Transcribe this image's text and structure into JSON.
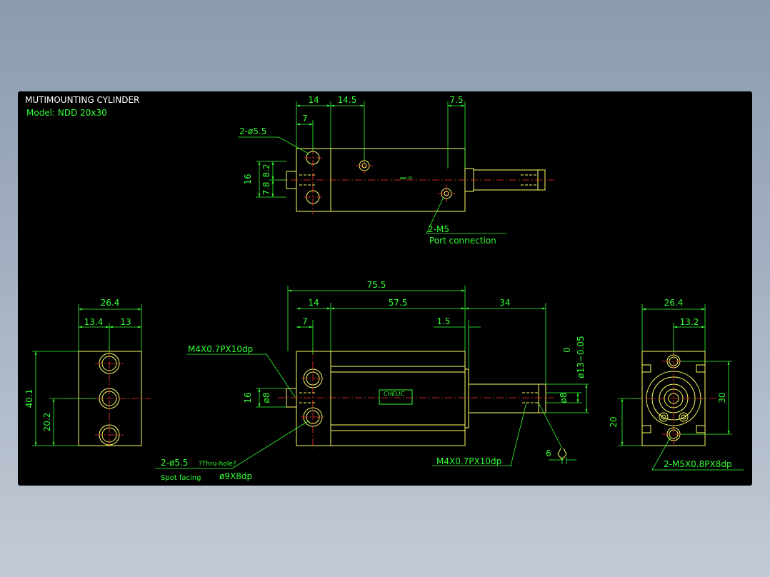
{
  "title": {
    "line1": "MUTIMOUNTING CYLINDER",
    "line2": "Model:  NDD 20x30"
  },
  "top_view": {
    "dim_14": "14",
    "dim_14_5": "14.5",
    "dim_7_5": "7.5",
    "dim_7": "7",
    "dim_16": "16",
    "dim_7_8": "7.8",
    "dim_8_2": "8.2",
    "hole_callout": "2-ø5.5",
    "port_callout": "2-M5",
    "port_desc": "Port connection",
    "centre_text": "øøø.20"
  },
  "left_view": {
    "dim_26_4": "26.4",
    "dim_13_4": "13.4",
    "dim_13": "13",
    "dim_40_1": "40.1",
    "dim_20_2": "20.2"
  },
  "front_view": {
    "dim_75_5": "75.5",
    "dim_14": "14",
    "dim_57_5": "57.5",
    "dim_34": "34",
    "dim_7": "7",
    "dim_1_5": "1.5",
    "dim_16": "16",
    "dim_phi8_left": "ø8",
    "dim_phi8_right": "ø8",
    "dim_tol_0": "0",
    "dim_phi13": "ø13−0.05",
    "thread_top": "M4X0.7PX10dp",
    "thread_bottom": "M4X0.7PX10dp",
    "hole_callout": "2-ø5.5",
    "thru_note": "?Thru-hole?",
    "spot_note": "Spot facing",
    "cbore": "ø9X8dp",
    "dim_6": "6",
    "brand": "CHELIC"
  },
  "right_view": {
    "dim_26_4": "26.4",
    "dim_13_2": "13.2",
    "dim_30": "30",
    "dim_20": "20",
    "thread_callout": "2-M5X0.8PX8dp"
  },
  "colors": {
    "background": "#000000",
    "outline": "#ffff66",
    "dimension": "#33ff33",
    "centerline": "#ff3333",
    "title": "#ffffff"
  }
}
